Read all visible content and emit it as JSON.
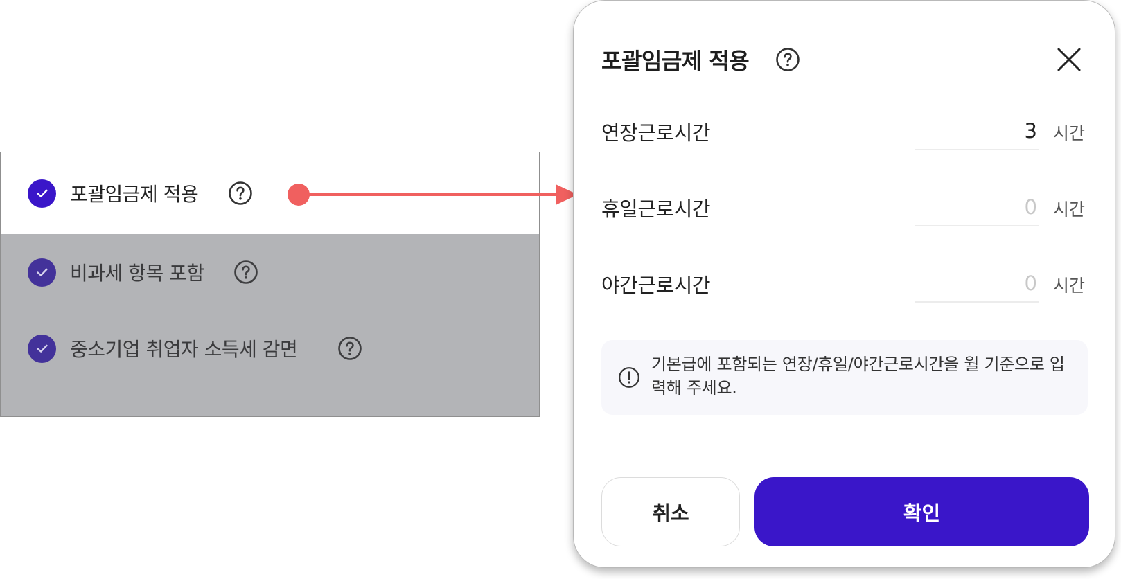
{
  "colors": {
    "accent": "#3a16c9",
    "accent_muted": "#43329a",
    "arrow": "#f0605f",
    "panel_dimmed": "#b3b4b7",
    "notice_bg": "#f7f7fb",
    "placeholder": "#c8c8c8"
  },
  "options_panel": {
    "items": [
      {
        "label": "포괄임금제 적용",
        "checked": true,
        "highlighted": true,
        "icon": "check-icon",
        "help_icon": "help-icon"
      },
      {
        "label": "비과세 항목 포함",
        "checked": true,
        "highlighted": false,
        "icon": "check-icon",
        "help_icon": "help-icon"
      },
      {
        "label": "중소기업 취업자 소득세 감면",
        "checked": true,
        "highlighted": false,
        "icon": "check-icon",
        "help_icon": "help-icon"
      }
    ]
  },
  "modal": {
    "title": "포괄임금제 적용",
    "help_icon": "help-icon",
    "close_icon": "close-icon",
    "fields": [
      {
        "label": "연장근로시간",
        "value": "3",
        "placeholder": "0",
        "unit": "시간"
      },
      {
        "label": "휴일근로시간",
        "value": "",
        "placeholder": "0",
        "unit": "시간"
      },
      {
        "label": "야간근로시간",
        "value": "",
        "placeholder": "0",
        "unit": "시간"
      }
    ],
    "notice": {
      "icon": "info-icon",
      "text": "기본급에 포함되는 연장/휴일/야간근로시간을 월 기준으로 입력해 주세요."
    },
    "buttons": {
      "cancel": "취소",
      "confirm": "확인"
    }
  }
}
